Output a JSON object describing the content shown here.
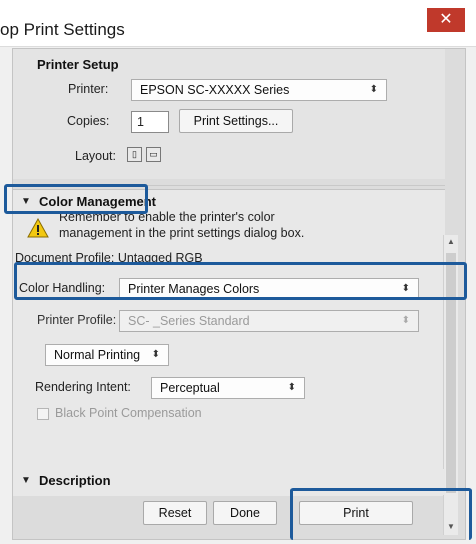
{
  "window": {
    "title": "op Print Settings",
    "close_glyph": "✕"
  },
  "printer_setup": {
    "title": "Printer Setup",
    "printer_label": "Printer:",
    "printer_value": "EPSON SC-XXXXX Series",
    "copies_label": "Copies:",
    "copies_value": "1",
    "print_settings_button": "Print Settings...",
    "layout_label": "Layout:",
    "layout_icons": [
      "portrait-icon",
      "landscape-icon"
    ]
  },
  "color_management": {
    "title": "Color Management",
    "warning_line1": "Remember to enable the printer's color",
    "warning_line2": "management in the print settings dialog box.",
    "document_profile": "Document Profile: Untagged RGB",
    "color_handling_label": "Color Handling:",
    "color_handling_value": "Printer Manages Colors",
    "printer_profile_label": "Printer Profile:",
    "printer_profile_value": "SC-          _Series Standard",
    "mode_value": "Normal Printing",
    "rendering_intent_label": "Rendering Intent:",
    "rendering_intent_value": "Perceptual",
    "black_point_label": "Black Point Compensation"
  },
  "description": {
    "title": "Description"
  },
  "buttons": {
    "reset": "Reset",
    "done": "Done",
    "print": "Print"
  },
  "colors": {
    "highlight": "#1d5a9b",
    "close": "#c0392b"
  }
}
